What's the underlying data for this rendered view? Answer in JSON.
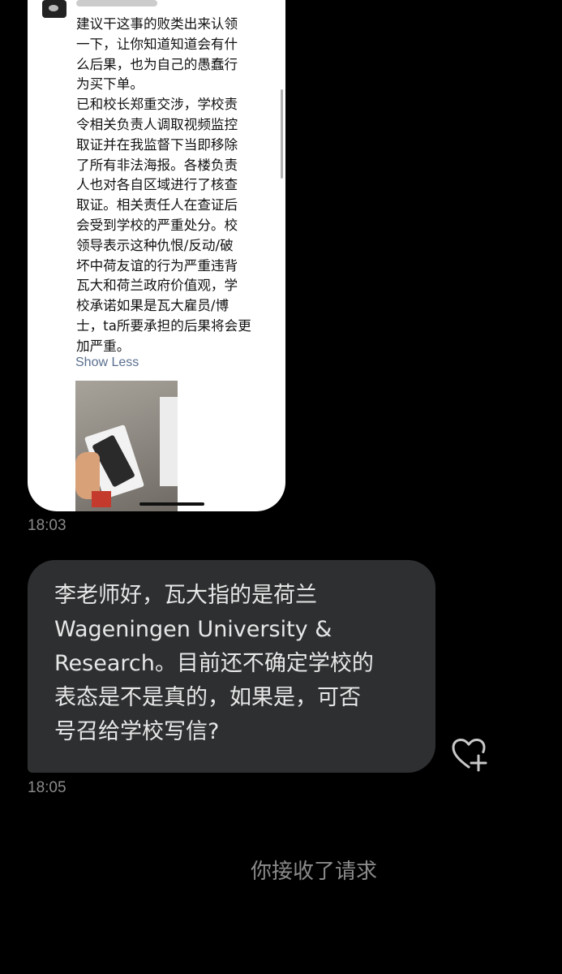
{
  "shared_image": {
    "post_text": "建议干这事的败类出来认领\n一下，让你知道知道会有什\n么后果，也为自己的愚蠢行\n为买下单。\n已和校长郑重交涉，学校责\n令相关负责人调取视频监控\n取证并在我监督下当即移除\n了所有非法海报。各楼负责\n人也对各自区域进行了核查\n取证。相关责任人在查证后\n会受到学校的严重处分。校\n领导表示这种仇恨/反动/破\n坏中荷友谊的行为严重违背\n瓦大和荷兰政府价值观，学\n校承诺如果是瓦大雇员/博\n士，ta所要承担的后果将会更\n加严重。",
    "show_less_label": "Show Less"
  },
  "messages": [
    {
      "timestamp": "18:03"
    },
    {
      "text": "李老师好，瓦大指的是荷兰\nWageningen University &\nResearch。目前还不确定学校的\n表态是不是真的，如果是，可否\n号召给学校写信?",
      "timestamp": "18:05"
    }
  ],
  "system_note": "你接收了请求",
  "icons": {
    "react": "heart-plus-icon"
  },
  "colors": {
    "background": "#000000",
    "bubble": "#2e2f31",
    "bubble_text": "#e7e7e7",
    "timestamp": "#8a8a8a",
    "link": "#5a6f8f"
  }
}
